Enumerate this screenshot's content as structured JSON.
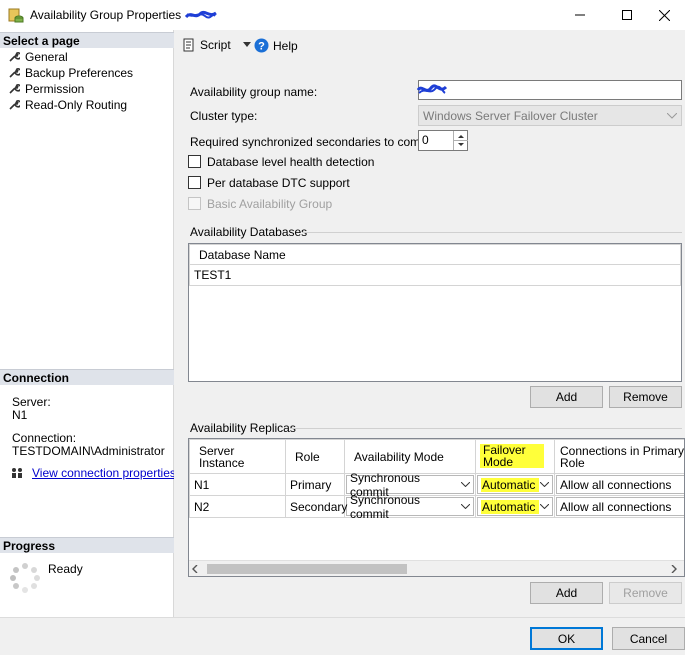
{
  "window": {
    "title": "Availability Group Properties"
  },
  "left": {
    "select_header": "Select a page",
    "pages": [
      "General",
      "Backup Preferences",
      "Permission",
      "Read-Only Routing"
    ],
    "connection_header": "Connection",
    "server_label": "Server:",
    "server_value": "N1",
    "connection_label": "Connection:",
    "connection_value": "TESTDOMAIN\\Administrator",
    "view_link": "View connection properties",
    "progress_header": "Progress",
    "progress_status": "Ready"
  },
  "toolbar": {
    "script_label": "Script",
    "help_label": "Help"
  },
  "general": {
    "ag_name_label": "Availability group name:",
    "cluster_type_label": "Cluster type:",
    "cluster_type_value": "Windows Server Failover Cluster",
    "required_sync_label": "Required synchronized secondaries to commit:",
    "required_sync_value": "0",
    "db_health_label": "Database level health detection",
    "dtc_label": "Per database DTC support",
    "basic_ag_label": "Basic Availability Group"
  },
  "databases": {
    "group_label": "Availability Databases",
    "column": "Database Name",
    "rows": [
      "TEST1"
    ],
    "add_label": "Add",
    "remove_label": "Remove"
  },
  "replicas": {
    "group_label": "Availability Replicas",
    "columns": {
      "server_instance": "Server Instance",
      "role": "Role",
      "availability_mode": "Availability Mode",
      "failover_mode": "Failover Mode",
      "connections": "Connections in Primary Role"
    },
    "rows": [
      {
        "server": "N1",
        "role": "Primary",
        "availability_mode": "Synchronous commit",
        "failover_mode": "Automatic",
        "connections": "Allow all connections"
      },
      {
        "server": "N2",
        "role": "Secondary",
        "availability_mode": "Synchronous commit",
        "failover_mode": "Automatic",
        "connections": "Allow all connections"
      }
    ],
    "add_label": "Add",
    "remove_label": "Remove"
  },
  "footer": {
    "ok_label": "OK",
    "cancel_label": "Cancel"
  },
  "colors": {
    "highlight": "#ffff3a",
    "link": "#0000cc",
    "accent": "#0078d7",
    "redaction": "#1f3fd6"
  }
}
